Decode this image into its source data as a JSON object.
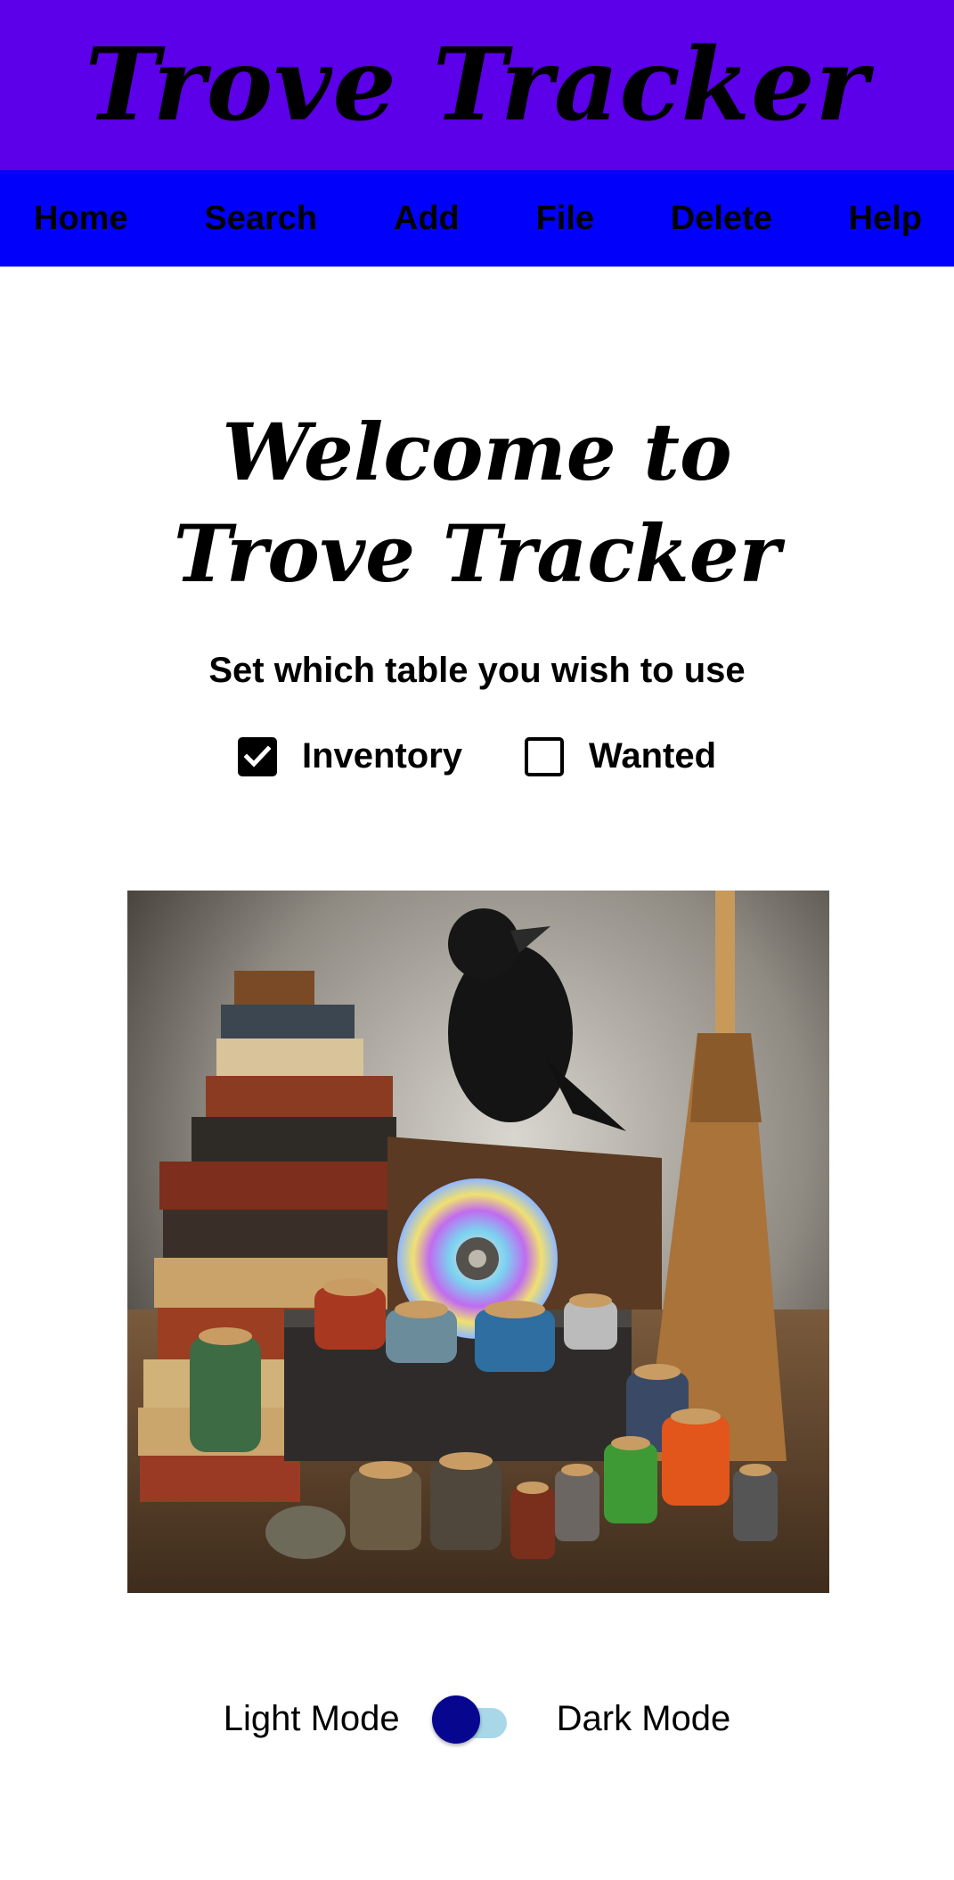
{
  "app": {
    "title": "Trove Tracker"
  },
  "nav": {
    "items": [
      {
        "label": "Home"
      },
      {
        "label": "Search"
      },
      {
        "label": "Add"
      },
      {
        "label": "File"
      },
      {
        "label": "Delete"
      },
      {
        "label": "Help"
      }
    ]
  },
  "main": {
    "welcome_line1": "Welcome to",
    "welcome_line2": "Trove Tracker",
    "subtitle": "Set which table you wish to use",
    "tables": [
      {
        "label": "Inventory",
        "checked": true
      },
      {
        "label": "Wanted",
        "checked": false
      }
    ],
    "hero_image": {
      "description_icon": "trove-illustration"
    }
  },
  "theme": {
    "light_label": "Light Mode",
    "dark_label": "Dark Mode",
    "dark_enabled": false
  },
  "colors": {
    "title_bar": "#5b00e8",
    "nav_bar": "#0000fb",
    "toggle_knob": "#06068f",
    "toggle_track": "#a8d8e8"
  }
}
